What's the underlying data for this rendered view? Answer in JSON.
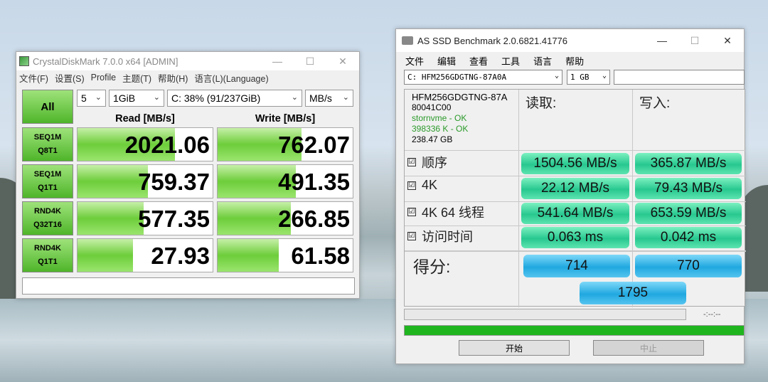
{
  "cdm": {
    "title": "CrystalDiskMark 7.0.0 x64 [ADMIN]",
    "menu": [
      "文件(F)",
      "设置(S)",
      "Profile",
      "主题(T)",
      "帮助(H)",
      "语言(L)(Language)"
    ],
    "all_label": "All",
    "count": "5",
    "size": "1GiB",
    "drive": "C: 38% (91/237GiB)",
    "unit": "MB/s",
    "read_header": "Read [MB/s]",
    "write_header": "Write [MB/s]",
    "rows": [
      {
        "l1": "SEQ1M",
        "l2": "Q8T1",
        "read": "2021.06",
        "write": "762.07",
        "read_fill": 0.72,
        "write_fill": 0.62
      },
      {
        "l1": "SEQ1M",
        "l2": "Q1T1",
        "read": "759.37",
        "write": "491.35",
        "read_fill": 0.52,
        "write_fill": 0.58
      },
      {
        "l1": "RND4K",
        "l2": "Q32T16",
        "read": "577.35",
        "write": "266.85",
        "read_fill": 0.49,
        "write_fill": 0.54
      },
      {
        "l1": "RND4K",
        "l2": "Q1T1",
        "read": "27.93",
        "write": "61.58",
        "read_fill": 0.41,
        "write_fill": 0.45
      }
    ]
  },
  "asd": {
    "title": "AS SSD Benchmark 2.0.6821.41776",
    "menu": [
      "文件",
      "编辑",
      "查看",
      "工具",
      "语言",
      "帮助"
    ],
    "drive": "C: HFM256GDGTNG-87A0A",
    "size": "1 GB",
    "info": {
      "model": "HFM256GDGTNG-87A",
      "fw": "80041C00",
      "driver": "stornvme - OK",
      "align": "398336 K - OK",
      "cap": "238.47 GB"
    },
    "read_header": "读取:",
    "write_header": "写入:",
    "rows": [
      {
        "label": "顺序",
        "read": "1504.56 MB/s",
        "write": "365.87 MB/s"
      },
      {
        "label": "4K",
        "read": "22.12 MB/s",
        "write": "79.43 MB/s"
      },
      {
        "label": "4K 64 线程",
        "read": "541.64 MB/s",
        "write": "653.59 MB/s"
      },
      {
        "label": "访问时间",
        "read": "0.063 ms",
        "write": "0.042 ms"
      }
    ],
    "score_label": "得分:",
    "score_read": "714",
    "score_write": "770",
    "score_total": "1795",
    "timer": "-:--:--",
    "start": "开始",
    "stop": "中止",
    "checkbox": "☑"
  }
}
